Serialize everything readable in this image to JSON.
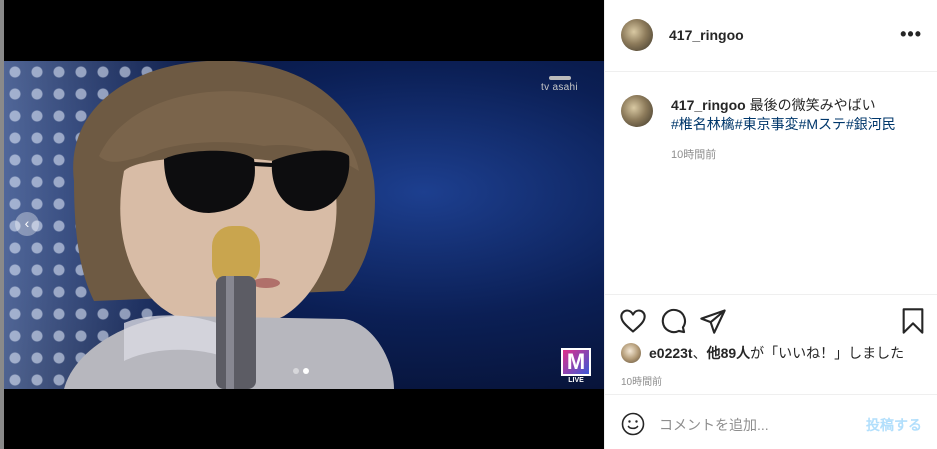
{
  "media": {
    "watermark": "tv asahi",
    "show_logo": "M",
    "show_logo_sub": "LIVE",
    "carousel": {
      "total": 2,
      "active_index": 1,
      "prev_arrow": "‹"
    }
  },
  "post": {
    "author": "417_ringoo",
    "more_icon": "•••",
    "caption_text": "最後の微笑みやばい",
    "hashtags": "#椎名林檎#東京事変#Mステ#銀河民",
    "caption_time": "10時間前"
  },
  "actions": {
    "like_icon": "heart-icon",
    "comment_icon": "comment-icon",
    "share_icon": "share-icon",
    "save_icon": "bookmark-icon"
  },
  "likes": {
    "first_user": "e0223t",
    "separator": "、",
    "others": "他89人",
    "suffix": "が「いいね！」しました"
  },
  "post_time": "10時間前",
  "comment_box": {
    "placeholder": "コメントを追加...",
    "post_label": "投稿する"
  },
  "colors": {
    "hashtag": "#00376b",
    "muted": "#8e8e8e",
    "post_button": "#b2dffc"
  }
}
